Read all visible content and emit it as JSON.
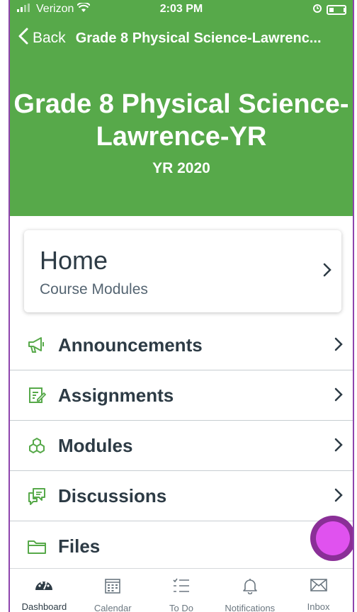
{
  "colors": {
    "brand_green": "#57a94a",
    "fab": "#e052ef",
    "fab_ring": "#8a2f97",
    "text": "#2d3b45"
  },
  "status": {
    "carrier": "Verizon",
    "time": "2:03 PM"
  },
  "nav": {
    "back_label": "Back",
    "title": "Grade 8 Physical Science-Lawrenc..."
  },
  "course": {
    "title": "Grade 8 Physical Science-Lawrence-YR",
    "term": "YR 2020"
  },
  "home": {
    "title": "Home",
    "subtitle": "Course Modules"
  },
  "items": [
    {
      "label": "Announcements",
      "icon": "megaphone-icon"
    },
    {
      "label": "Assignments",
      "icon": "assignment-icon"
    },
    {
      "label": "Modules",
      "icon": "modules-icon"
    },
    {
      "label": "Discussions",
      "icon": "discussions-icon"
    },
    {
      "label": "Files",
      "icon": "folder-icon"
    }
  ],
  "tabs": [
    {
      "label": "Dashboard",
      "icon": "dashboard-icon",
      "active": true
    },
    {
      "label": "Calendar",
      "icon": "calendar-icon"
    },
    {
      "label": "To Do",
      "icon": "todo-icon"
    },
    {
      "label": "Notifications",
      "icon": "bell-icon"
    },
    {
      "label": "Inbox",
      "icon": "inbox-icon"
    }
  ]
}
